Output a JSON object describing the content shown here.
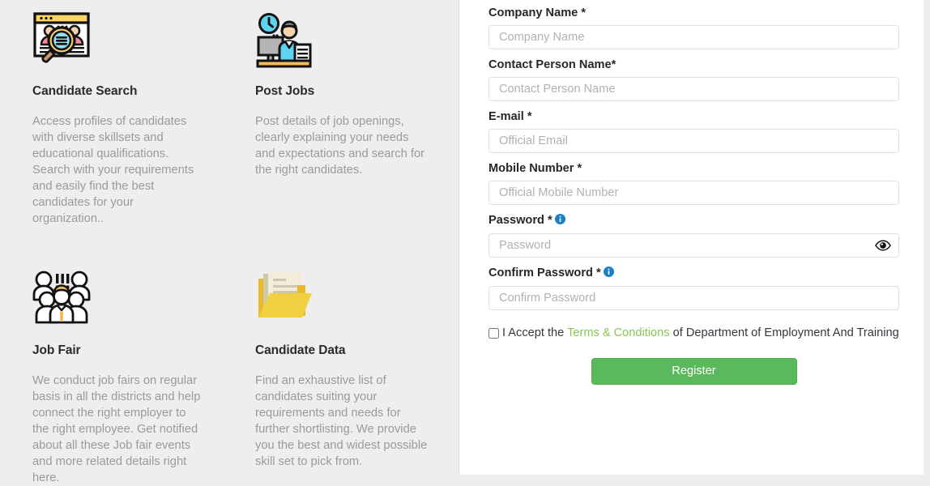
{
  "features": [
    {
      "icon": "candidate-search-icon",
      "title": "Candidate Search",
      "description": "Access profiles of candidates with diverse skillsets and educational qualifications. Search with your requirements and easily find the best candidates for your organization.."
    },
    {
      "icon": "post-jobs-icon",
      "title": "Post Jobs",
      "description": "Post details of job openings, clearly explaining your needs and expectations and search for the right candidates."
    },
    {
      "icon": "job-fair-icon",
      "title": "Job Fair",
      "description": "We conduct job fairs on regular basis in all the districts and help connect the right employer to the right employee. Get notified about all these Job fair events and more related details right here."
    },
    {
      "icon": "candidate-data-icon",
      "title": "Candidate Data",
      "description": "Find an exhaustive list of candidates suiting your requirements and needs for further shortlisting. We provide you the best and widest possible skill set to pick from."
    }
  ],
  "form": {
    "fields": [
      {
        "label": "Company Name *",
        "placeholder": "Company Name",
        "value": "",
        "type": "text",
        "name": "company-name",
        "info": false,
        "eye": false
      },
      {
        "label": "Contact Person Name*",
        "placeholder": "Contact Person Name",
        "value": "",
        "type": "text",
        "name": "contact-person-name",
        "info": false,
        "eye": false
      },
      {
        "label": "E-mail *",
        "placeholder": "Official Email",
        "value": "",
        "type": "email",
        "name": "email",
        "info": false,
        "eye": false
      },
      {
        "label": "Mobile Number *",
        "placeholder": "Official Mobile Number",
        "value": "",
        "type": "tel",
        "name": "mobile-number",
        "info": false,
        "eye": false
      },
      {
        "label": "Password *",
        "placeholder": "Password",
        "value": "",
        "type": "password",
        "name": "password",
        "info": true,
        "eye": true
      },
      {
        "label": "Confirm Password *",
        "placeholder": "Confirm Password",
        "value": "",
        "type": "password",
        "name": "confirm-password",
        "info": true,
        "eye": false
      }
    ],
    "terms": {
      "prefix": "I Accept the ",
      "link": "Terms & Conditions",
      "suffix": " of Department of Employment And Training",
      "checked": false
    },
    "submit_label": "Register"
  },
  "colors": {
    "accent_green": "#5cb85c",
    "link_green": "#88c656",
    "info_blue": "#1b7fc4",
    "panel_bg": "#eeeeee",
    "form_bg": "#ffffff",
    "muted_text": "#9a9a9a"
  }
}
